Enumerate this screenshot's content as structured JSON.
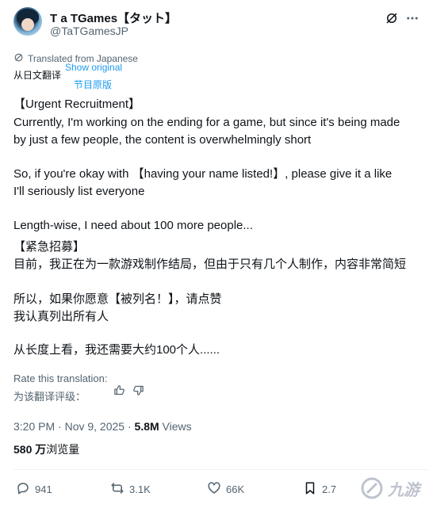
{
  "author": {
    "display_name": "T a TGames【タット】",
    "handle": "@TaTGamesJP"
  },
  "translation": {
    "translated_from": "Translated from Japanese",
    "translated_from_zh": "从日文翻译",
    "show_original": "Show original",
    "show_original_zh": "节目原版"
  },
  "body": {
    "lines": [
      "【Urgent Recruitment】",
      "Currently, I'm working on the ending for a game, but since it's being made",
      "by just a few people, the content is overwhelmingly short",
      "So, if you're okay with 【having your name listed!】, please give it a like",
      "I'll seriously list everyone",
      "Length-wise, I need about 100 more people...",
      "【紧急招募】",
      "目前，我正在为一款游戏制作结局，但由于只有几个人制作，内容非常简短",
      "所以，如果你愿意【被列名！】，请点赞",
      "我认真列出所有人",
      "从长度上看，我还需要大约100个人......"
    ]
  },
  "rate": {
    "label": "Rate this translation:",
    "label_zh": "为该翻译评级："
  },
  "meta": {
    "time": "3:20 PM · Nov 9, 2025 · ",
    "views_count": "5.8M",
    "views_label": " Views",
    "views_zh_count": "580 万",
    "views_zh_label": "浏览量"
  },
  "actions": {
    "replies": "941",
    "reposts": "3.1K",
    "likes": "66K",
    "bookmarks": "2.7"
  },
  "watermark": {
    "text": "九游"
  },
  "icons": {
    "grok": "grok-icon",
    "more": "more-icon",
    "translate": "translate-icon",
    "thumb_up": "thumb-up-icon",
    "thumb_down": "thumb-down-icon",
    "reply": "reply-icon",
    "repost": "repost-icon",
    "like": "like-icon",
    "bookmark": "bookmark-icon"
  },
  "colors": {
    "accent": "#1d9bf0",
    "secondary_text": "#536471",
    "primary_text": "#0f1419"
  }
}
